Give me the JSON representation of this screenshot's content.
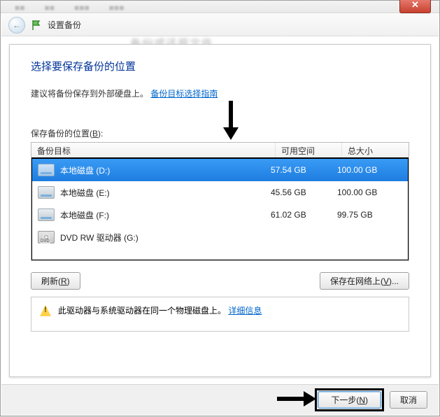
{
  "window": {
    "close_glyph": "✕",
    "back_glyph": "←",
    "header_title": "设置备份"
  },
  "wizard": {
    "title": "选择要保存备份的位置",
    "advice_prefix": "建议将备份保存到外部硬盘上。",
    "advice_link": "备份目标选择指南",
    "list_label_prefix": "保存备份的位置(",
    "list_label_key": "B",
    "list_label_suffix": "):"
  },
  "table": {
    "headers": {
      "target": "备份目标",
      "free": "可用空间",
      "total": "总大小"
    },
    "rows": [
      {
        "name": "本地磁盘 (D:)",
        "free": "57.54 GB",
        "total": "100.00 GB",
        "type": "hdd",
        "selected": true
      },
      {
        "name": "本地磁盘 (E:)",
        "free": "45.56 GB",
        "total": "100.00 GB",
        "type": "hdd",
        "selected": false
      },
      {
        "name": "本地磁盘 (F:)",
        "free": "61.02 GB",
        "total": "99.75 GB",
        "type": "hdd",
        "selected": false
      },
      {
        "name": "DVD RW 驱动器 (G:)",
        "free": "",
        "total": "",
        "type": "dvd",
        "selected": false
      }
    ]
  },
  "buttons": {
    "refresh_prefix": "刷新(",
    "refresh_key": "R",
    "refresh_suffix": ")",
    "save_network_prefix": "保存在网络上(",
    "save_network_key": "V",
    "save_network_suffix": ")...",
    "next_prefix": "下一步(",
    "next_key": "N",
    "next_suffix": ")",
    "cancel": "取消"
  },
  "info": {
    "warning_text": "此驱动器与系统驱动器在同一个物理磁盘上。",
    "details_link": "详细信息"
  }
}
